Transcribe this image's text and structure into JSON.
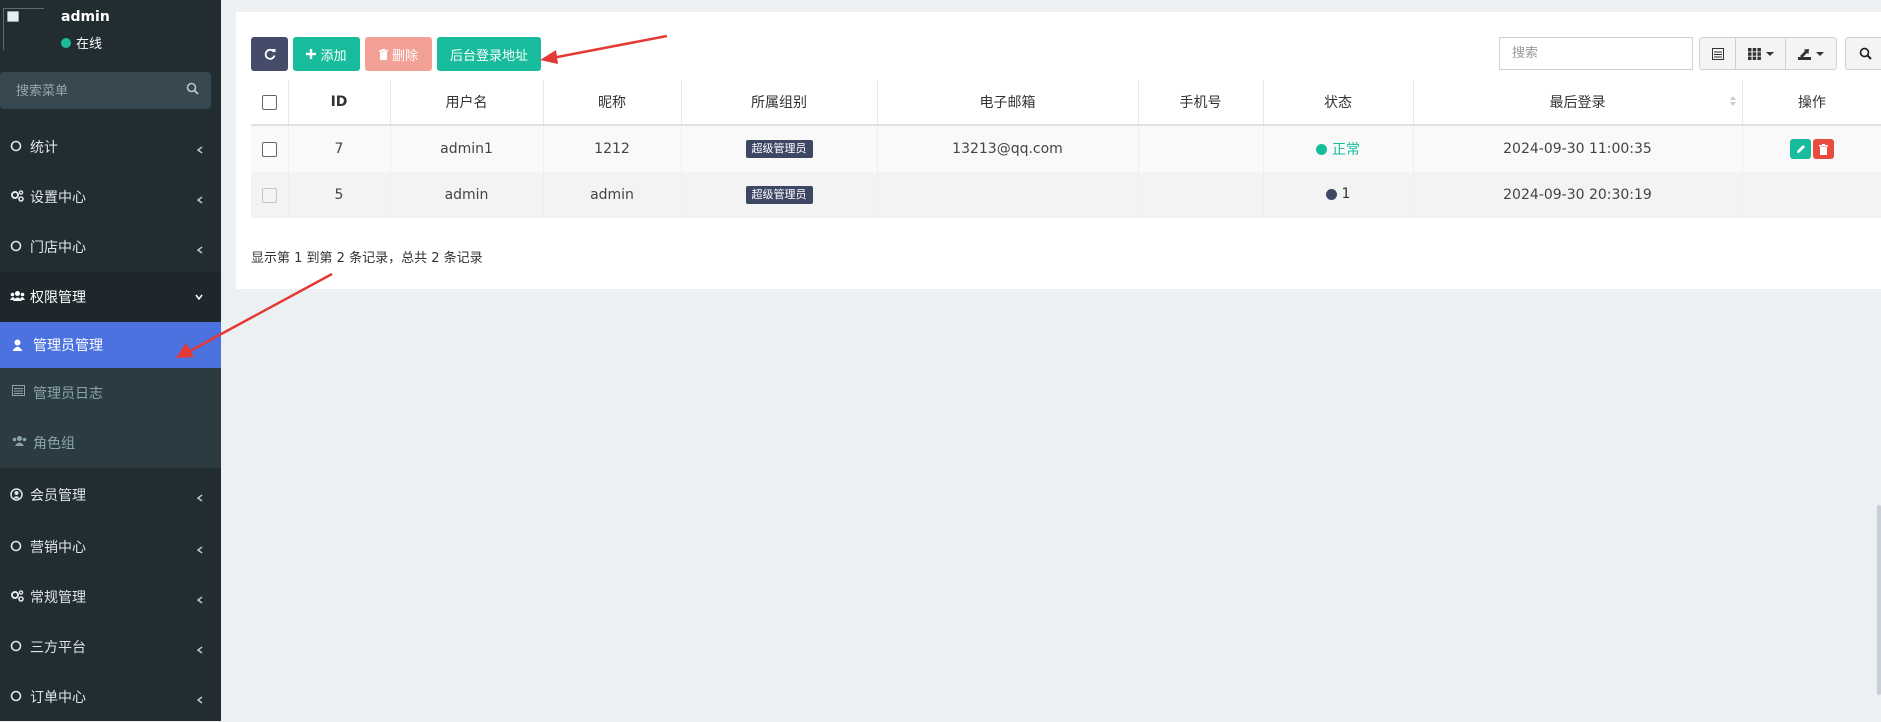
{
  "user": {
    "name": "admin",
    "status": "在线"
  },
  "sidebar": {
    "search_placeholder": "搜索菜单",
    "items": [
      {
        "label": "统计",
        "icon": "circle-icon"
      },
      {
        "label": "设置中心",
        "icon": "cogs-icon"
      },
      {
        "label": "门店中心",
        "icon": "circle-icon"
      },
      {
        "label": "权限管理",
        "icon": "users-icon",
        "open": true,
        "children": [
          {
            "label": "管理员管理",
            "icon": "user-icon",
            "active": true
          },
          {
            "label": "管理员日志",
            "icon": "list-icon"
          },
          {
            "label": "角色组",
            "icon": "users-icon"
          }
        ]
      },
      {
        "label": "会员管理",
        "icon": "user-circle-icon"
      },
      {
        "label": "营销中心",
        "icon": "circle-icon"
      },
      {
        "label": "常规管理",
        "icon": "cogs-icon"
      },
      {
        "label": "三方平台",
        "icon": "circle-icon"
      },
      {
        "label": "订单中心",
        "icon": "circle-icon"
      }
    ]
  },
  "toolbar": {
    "add_label": "添加",
    "delete_label": "删除",
    "login_url_label": "后台登录地址",
    "search_placeholder": "搜索"
  },
  "table": {
    "columns": [
      "ID",
      "用户名",
      "昵称",
      "所属组别",
      "电子邮箱",
      "手机号",
      "状态",
      "最后登录",
      "操作"
    ],
    "rows": [
      {
        "id": "7",
        "username": "admin1",
        "nickname": "1212",
        "group": "超级管理员",
        "email": "13213@qq.com",
        "phone": "",
        "status": "正常",
        "last_login": "2024-09-30 11:00:35"
      },
      {
        "id": "5",
        "username": "admin",
        "nickname": "admin",
        "group": "超级管理员",
        "email": "",
        "phone": "",
        "status": "1",
        "last_login": "2024-09-30 20:30:19"
      }
    ]
  },
  "pagination_info": "显示第 1 到第 2 条记录，总共 2 条记录",
  "colors": {
    "sidebar_bg": "#222d32",
    "active_item": "#4c72e0",
    "success": "#18bc9c",
    "danger": "#e74c3c",
    "dark_button": "#444c6a",
    "annotation_arrow": "#e53935"
  }
}
